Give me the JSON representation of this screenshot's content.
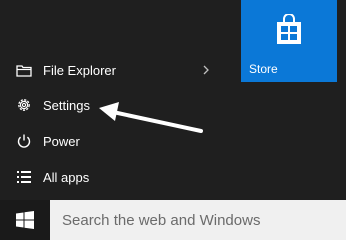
{
  "colors": {
    "menu_bg": "#1f1f1f",
    "taskbar_bg": "#101010",
    "tile_blue": "#0b78d7",
    "search_bg": "#f0f0f0",
    "arrow": "#ffffff"
  },
  "tiles": {
    "store_label": "Store",
    "store_icon": "store-bag-icon"
  },
  "menu": {
    "items": [
      {
        "label": "File Explorer",
        "icon": "folder-icon",
        "has_submenu": true
      },
      {
        "label": "Settings",
        "icon": "gear-icon",
        "has_submenu": false
      },
      {
        "label": "Power",
        "icon": "power-icon",
        "has_submenu": false
      },
      {
        "label": "All apps",
        "icon": "list-icon",
        "has_submenu": false
      }
    ]
  },
  "taskbar": {
    "start_icon": "windows-logo-icon",
    "search_placeholder": "Search the web and Windows"
  }
}
